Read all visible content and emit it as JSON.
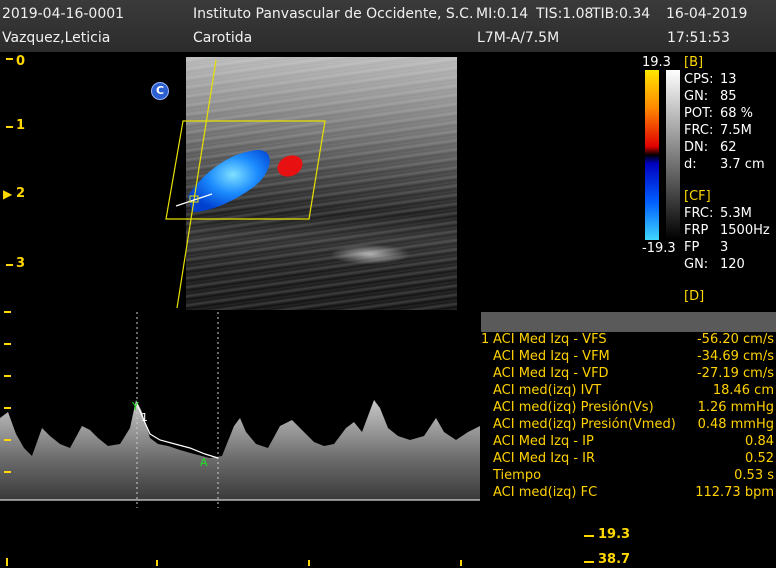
{
  "header": {
    "patient_id": "2019-04-16-0001",
    "patient_name": "Vazquez,Leticia",
    "institution": "Instituto Panvascular de Occidente, S.C.",
    "mi": "MI:0.14",
    "tis": "TIS:1.08",
    "tib": "TIB:0.34",
    "date": "16-04-2019",
    "exam": "Carotida",
    "probe": "L7M-A/7.5M",
    "time": "17:51:53"
  },
  "depth_scale": [
    "0",
    "1",
    "2",
    "3"
  ],
  "color_marker": "C",
  "color_bar": {
    "max": "19.3",
    "min": "-19.3"
  },
  "params": {
    "b_section": "[B]",
    "b_rows": [
      {
        "label": "CPS:",
        "value": "13"
      },
      {
        "label": "GN:",
        "value": "85"
      },
      {
        "label": "POT:",
        "value": "68 %"
      },
      {
        "label": "FRC:",
        "value": "7.5M"
      },
      {
        "label": "DN:",
        "value": "62"
      },
      {
        "label": "d:",
        "value": "3.7 cm"
      }
    ],
    "cf_section": "[CF]",
    "cf_rows": [
      {
        "label": "FRC:",
        "value": "5.3M"
      },
      {
        "label": "FRP",
        "value": "1500Hz"
      },
      {
        "label": "FP",
        "value": "3"
      },
      {
        "label": "GN:",
        "value": "120"
      }
    ],
    "d_section": "[D]"
  },
  "measurements": {
    "index": "1",
    "rows": [
      {
        "label": "ACI Med Izq - VFS",
        "value": "-56.20 cm/s"
      },
      {
        "label": "ACI Med Izq - VFM",
        "value": "-34.69 cm/s"
      },
      {
        "label": "ACI Med Izq - VFD",
        "value": "-27.19 cm/s"
      },
      {
        "label": "ACI med(izq) IVT",
        "value": "18.46 cm"
      },
      {
        "label": "ACI med(izq) Presión(Vs)",
        "value": "1.26 mmHg"
      },
      {
        "label": "ACI med(izq) Presión(Vmed)",
        "value": "0.48 mmHg"
      },
      {
        "label": "ACI Med Izq - IP",
        "value": "0.84"
      },
      {
        "label": "ACI Med Izq - IR",
        "value": "0.52"
      },
      {
        "label": "Tiempo",
        "value": "0.53 s"
      },
      {
        "label": "ACI med(izq) FC",
        "value": "112.73 bpm"
      }
    ]
  },
  "spectral": {
    "cursor_label": "1",
    "velocity_labels": [
      "19.3",
      "38.7"
    ]
  },
  "colors": {
    "accent_yellow": "#ffd800",
    "measurement_text": "#ffd200",
    "header_bg": "#2c2c2c"
  }
}
